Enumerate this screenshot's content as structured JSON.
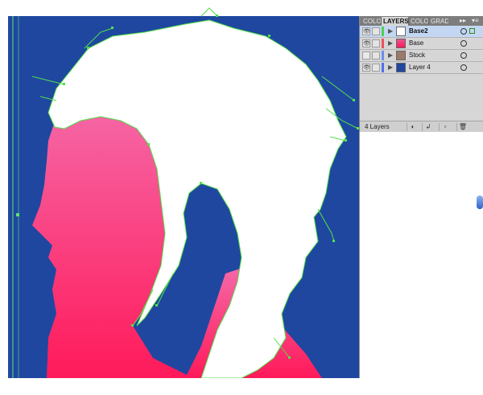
{
  "panel": {
    "tabs": [
      "COLO",
      "LAYERS",
      "COLO",
      "GRAD"
    ],
    "active_tab": "LAYERS",
    "collapse_glyph": "▸▸",
    "menu_glyph": "▾≡",
    "footer_count": "4 Layers",
    "footer_buttons": [
      "make-clipping-mask",
      "create-sublayer",
      "create-layer",
      "delete-layer"
    ]
  },
  "layers": [
    {
      "name": "Base2",
      "color": "#4fd04f",
      "thumb": "#ffffff",
      "selected": true
    },
    {
      "name": "Base",
      "color": "#f04f5a",
      "thumb": "#e9558f",
      "selected": false
    },
    {
      "name": "Stock",
      "color": "#6a8ef0",
      "thumb": "#9c7a6a",
      "selected": false
    },
    {
      "name": "Layer 4",
      "color": "#4f6ff0",
      "thumb": "#1f47a0",
      "selected": false
    }
  ],
  "colors": {
    "canvas_bg": "#1f47a0",
    "face_top": "#f56aa9",
    "face_bottom": "#ff1a5a",
    "hair": "#ffffff",
    "path_highlight": "#53e04a",
    "selection": "#c4d7f2"
  }
}
